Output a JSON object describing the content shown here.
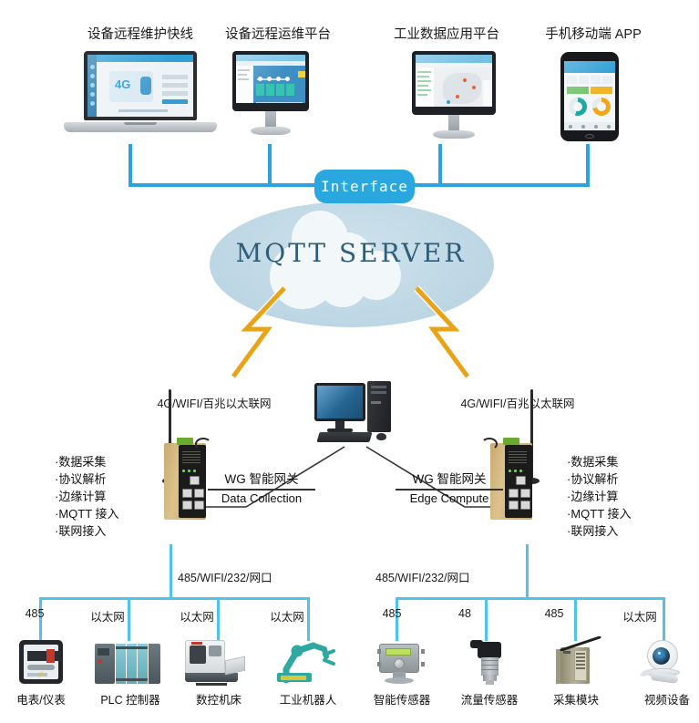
{
  "diagram": {
    "title": "MQTT IoT Architecture",
    "colors": {
      "bus_primary": "#2BA3DE",
      "bus_secondary": "#4FC3E8",
      "interface_badge": "#29A7DE",
      "cloud_fill": "#BFD8E5",
      "mqtt_text": "#2F5D78",
      "lightning": "#E8A317",
      "gateway_body": "#C8AB72"
    }
  },
  "top_tier": {
    "apps": [
      {
        "label": "设备远程维护快线",
        "device": "laptop-screen"
      },
      {
        "label": "设备远程运维平台",
        "device": "monitor-screen"
      },
      {
        "label": "工业数据应用平台",
        "device": "monitor-screen"
      },
      {
        "label": "手机移动端 APP",
        "device": "phone-screen"
      }
    ]
  },
  "interface": {
    "label": "Interface"
  },
  "cloud": {
    "label": "MQTT SERVER"
  },
  "middle_tier": {
    "pc": {
      "name": "desktop-computer"
    },
    "gateways": [
      {
        "uplink": "4G/WIFI/百兆以太联网",
        "caption_cn": "WG 智能网关",
        "caption_en": "Data Collection",
        "features": [
          "·数据采集",
          "·协议解析",
          "·边缘计算",
          "·MQTT 接入",
          "·联网接入"
        ]
      },
      {
        "uplink": "4G/WIFI/百兆以太联网",
        "caption_cn": "WG 智能网关",
        "caption_en": "Edge Compute",
        "features": [
          "·数据采集",
          "·协议解析",
          "·边缘计算",
          "·MQTT 接入",
          "·联网接入"
        ]
      }
    ]
  },
  "bottom_tier": {
    "groups": [
      {
        "bus_label": "485/WIFI/232/网口",
        "devices": [
          {
            "protocol": "485",
            "label": "电表/仪表",
            "icon": "electric-meter-icon"
          },
          {
            "protocol": "以太网",
            "label": "PLC 控制器",
            "icon": "plc-controller-icon"
          },
          {
            "protocol": "以太网",
            "label": "数控机床",
            "icon": "cnc-machine-icon"
          },
          {
            "protocol": "以太网",
            "label": "工业机器人",
            "icon": "industrial-robot-icon"
          }
        ]
      },
      {
        "bus_label": "485/WIFI/232/网口",
        "devices": [
          {
            "protocol": "485",
            "label": "智能传感器",
            "icon": "smart-sensor-icon"
          },
          {
            "protocol": "48",
            "label": "流量传感器",
            "icon": "flow-sensor-icon"
          },
          {
            "protocol": "485",
            "label": "采集模块",
            "icon": "acquisition-module-icon"
          },
          {
            "protocol": "以太网",
            "label": "视频设备",
            "icon": "video-camera-icon"
          }
        ]
      }
    ]
  }
}
